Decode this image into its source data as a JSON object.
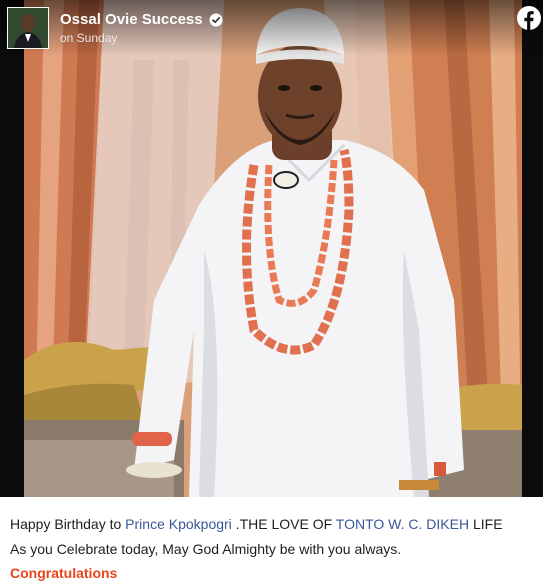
{
  "post": {
    "author": "Ossal Ovie Success",
    "timestamp": "on Sunday",
    "verified_icon": "verified-badge-icon",
    "platform_icon": "facebook-logo-icon",
    "image_alt": "man in white traditional attire with coral beads and white cap"
  },
  "caption": {
    "line1_prefix": "Happy Birthday to ",
    "line1_mention1": "Prince Kpokpogri",
    "line1_middle": " .THE LOVE OF ",
    "line1_mention2": "TONTO W. C. DIKEH",
    "line1_suffix": " LIFE",
    "line2": "As you Celebrate today, May God Almighty be with you always.",
    "line3": "Congratulations"
  },
  "colors": {
    "link": "#385898",
    "highlight": "#e8451c",
    "body_text": "#1c1e21",
    "facebook_blue": "#1877f2"
  }
}
